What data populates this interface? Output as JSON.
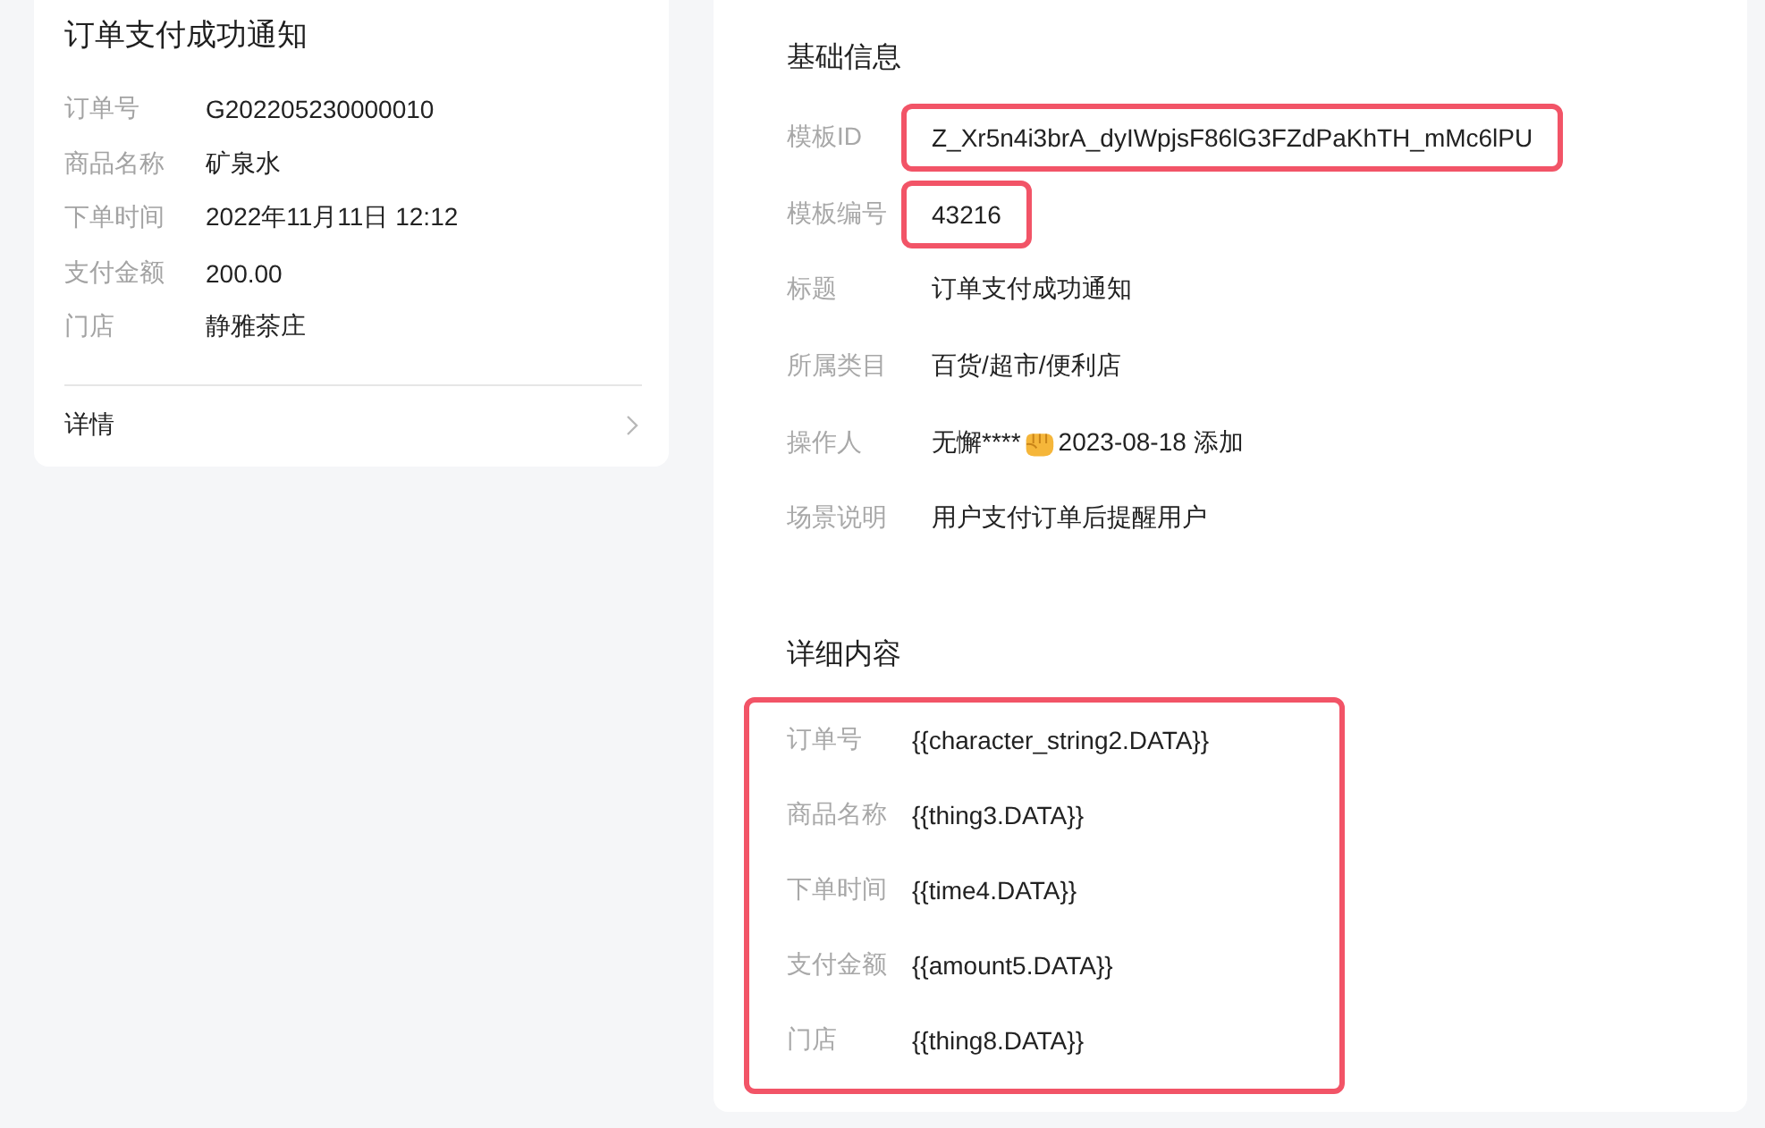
{
  "card": {
    "title": "订单支付成功通知",
    "fields": [
      {
        "label": "订单号",
        "value": "G202205230000010"
      },
      {
        "label": "商品名称",
        "value": "矿泉水"
      },
      {
        "label": "下单时间",
        "value": "2022年11月11日 12:12"
      },
      {
        "label": "支付金额",
        "value": "200.00"
      },
      {
        "label": "门店",
        "value": "静雅茶庄"
      }
    ],
    "footer": {
      "label": "详情"
    }
  },
  "panel": {
    "sections": [
      {
        "kind": "basic",
        "title": "基础信息",
        "rows": [
          {
            "kind": "text",
            "label": "模板ID",
            "value": "Z_Xr5n4i3brA_dyIWpjsF86lG3FZdPaKhTH_mMc6lPU",
            "highlighted": true
          },
          {
            "kind": "text",
            "label": "模板编号",
            "value": "43216",
            "highlighted": true
          },
          {
            "kind": "text",
            "label": "标题",
            "value": "订单支付成功通知",
            "highlighted": false
          },
          {
            "kind": "text",
            "label": "所属类目",
            "value": "百货/超市/便利店",
            "highlighted": false
          },
          {
            "kind": "operator",
            "label": "操作人",
            "value": "无懈****",
            "note": "2023-08-18 添加",
            "highlighted": false
          },
          {
            "kind": "text",
            "label": "场景说明",
            "value": "用户支付订单后提醒用户",
            "highlighted": false
          }
        ]
      },
      {
        "kind": "detail",
        "title": "详细内容",
        "highlighted": true,
        "rows": [
          {
            "kind": "text",
            "label": "订单号",
            "value": "{{character_string2.DATA}}"
          },
          {
            "kind": "text",
            "label": "商品名称",
            "value": "{{thing3.DATA}}"
          },
          {
            "kind": "text",
            "label": "下单时间",
            "value": "{{time4.DATA}}"
          },
          {
            "kind": "text",
            "label": "支付金额",
            "value": "{{amount5.DATA}}"
          },
          {
            "kind": "text",
            "label": "门店",
            "value": "{{thing8.DATA}}"
          }
        ]
      }
    ]
  }
}
